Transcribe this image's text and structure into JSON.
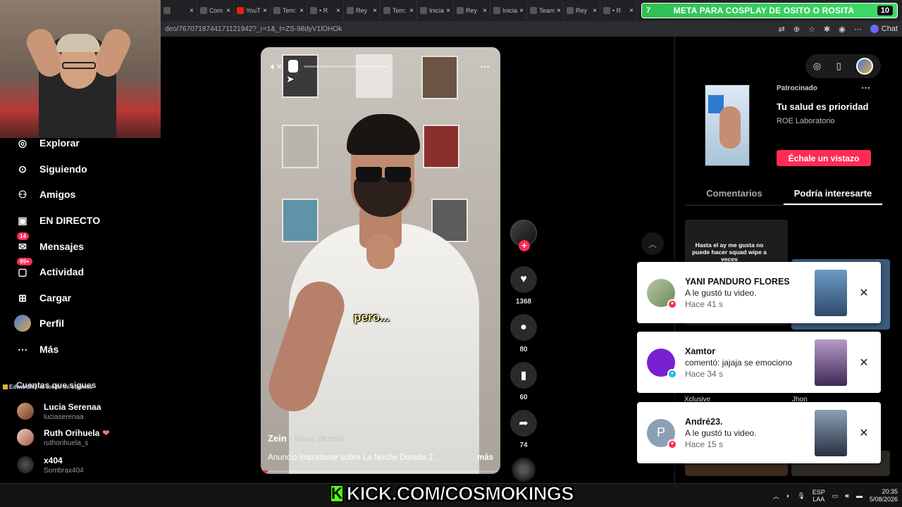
{
  "browser": {
    "tabs": [
      {
        "label": "",
        "icon": "tiktok"
      },
      {
        "label": "Com",
        "icon": "tiktok"
      },
      {
        "label": "YouT",
        "icon": "youtube"
      },
      {
        "label": "Tem:",
        "icon": "tiktok"
      },
      {
        "label": "• R",
        "icon": "tiktok"
      },
      {
        "label": "Rey",
        "icon": "tiktok"
      },
      {
        "label": "Tem:",
        "icon": "tiktok"
      },
      {
        "label": "Inicia",
        "icon": "tiktok"
      },
      {
        "label": "Rey",
        "icon": "tiktok"
      },
      {
        "label": "Inicia",
        "icon": "tiktok"
      },
      {
        "label": "Team",
        "icon": "tiktok"
      },
      {
        "label": "Rey",
        "icon": "tiktok"
      },
      {
        "label": "• R",
        "icon": "tiktok"
      }
    ],
    "url": "deo/7670718744171121942?_r=1&_t=ZS-98dyV1lOHOk",
    "chat_label": "Chat"
  },
  "goal_banner": {
    "left_number": "7",
    "text": "META PARA COSPLAY DE OSITO O ROSITA",
    "right_number": "10"
  },
  "sidebar": {
    "items": [
      {
        "label": "Explorar",
        "icon": "compass-icon"
      },
      {
        "label": "Siguiendo",
        "icon": "following-icon"
      },
      {
        "label": "Amigos",
        "icon": "friends-icon"
      },
      {
        "label": "EN DIRECTO",
        "icon": "live-icon"
      },
      {
        "label": "Mensajes",
        "icon": "messages-icon",
        "badge": "14"
      },
      {
        "label": "Actividad",
        "icon": "activity-icon",
        "badge": "99+"
      },
      {
        "label": "Cargar",
        "icon": "upload-icon"
      },
      {
        "label": "Perfil",
        "icon": "profile-icon"
      },
      {
        "label": "Más",
        "icon": "more-icon"
      }
    ],
    "following_title": "Cuentas que sigues",
    "following": [
      {
        "name": "Lucia Serenaa",
        "handle": "luciaserenaa",
        "emoji": ""
      },
      {
        "name": "Ruth Orihuela",
        "handle": "ruthorihuela_s",
        "emoji": "❤"
      },
      {
        "name": "x404",
        "handle": "Sombrax404",
        "emoji": ""
      }
    ],
    "overlay_note": "Edwardhq: is tocito mi cosmos"
  },
  "video": {
    "subtitle": "pero...",
    "author": "Zein",
    "time": "· Hace 28 min",
    "description": "Anuncio Importante sobre La Noche Dorada 2 …",
    "more_label": "más",
    "progress": 0.03
  },
  "actions": {
    "likes": "1368",
    "comments": "80",
    "saves": "60",
    "shares": "74"
  },
  "ad": {
    "sponsored": "Patrocinado",
    "title": "Tu salud es prioridad",
    "brand": "ROE Laboratorio",
    "cta": "Échale un vistazo"
  },
  "right_tabs": {
    "comments": "Comentarios",
    "suggested": "Podría interesarte"
  },
  "suggested_text": "Hasta el ay me gusta no puede hacer squad wipe a veces",
  "suggested_captions": [
    "Xclusive",
    "Jhon"
  ],
  "notifications": [
    {
      "name": "YANI PANDURO FLORES",
      "action": "A le gustó tu video.",
      "time": "Hace 41 s",
      "type": "like"
    },
    {
      "name": "Xamtor",
      "action": "comentó: jajaja se emociono",
      "time": "Hace 34 s",
      "type": "comment"
    },
    {
      "name": "André23.",
      "action": "A le gustó tu video.",
      "time": "Hace 15 s",
      "type": "like",
      "initial": "P"
    }
  ],
  "taskbar": {
    "lang_top": "ESP",
    "lang_bottom": "LAA",
    "time": "20:35",
    "date": "5/08/2026"
  },
  "overlay": {
    "kick_text": "KICK.COM/COSMOKINGS",
    "kick_letter": "K"
  },
  "colors": {
    "accent": "#fe2c55",
    "goal": "#3ddc6a",
    "kick": "#53fc18"
  }
}
